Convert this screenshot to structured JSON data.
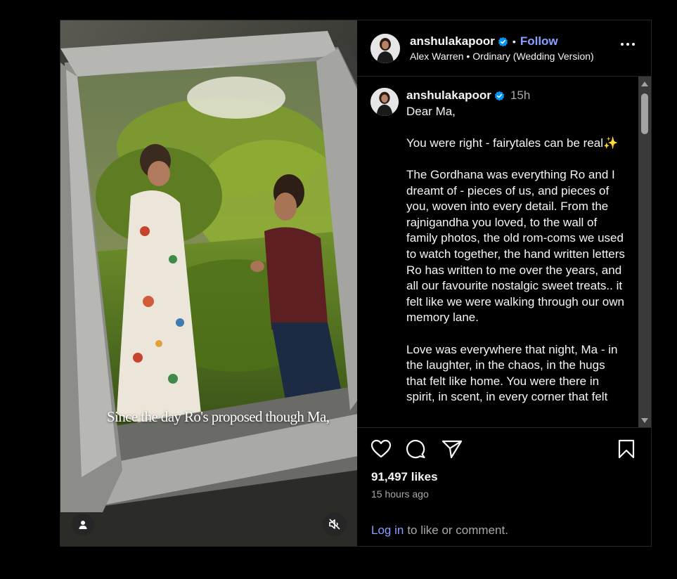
{
  "media": {
    "overlay_caption": "Since the day Ro's proposed though Ma,",
    "tag_icon": "user-icon",
    "mute_icon": "speaker-muted-icon"
  },
  "header": {
    "username": "anshulakapoor",
    "verified_icon": "verified-badge-icon",
    "separator": "•",
    "follow_label": "Follow",
    "audio_artist": "Alex Warren",
    "audio_separator": "•",
    "audio_track": "Ordinary (Wedding Version)",
    "more_icon": "more-options-icon"
  },
  "caption": {
    "username": "anshulakapoor",
    "time": "15h",
    "paragraphs": [
      "Dear Ma,",
      "You were right - fairytales can be real✨",
      "The Gordhana was everything Ro and I dreamt of - pieces of us, and pieces of you, woven into every detail. From the rajnigandha you loved, to the wall of family photos, the old rom-coms we used to watch together, the hand written letters Ro has written to me over the years, and all our favourite nostalgic sweet treats.. it felt like we were walking through our own memory lane.",
      "Love was everywhere that night, Ma - in the laughter, in the chaos, in the hugs that felt like home. You were there in spirit, in scent, in every corner that felt"
    ]
  },
  "actions": {
    "like_icon": "heart-icon",
    "comment_icon": "comment-icon",
    "share_icon": "share-icon",
    "save_icon": "bookmark-icon",
    "likes": "91,497 likes",
    "posted": "15 hours ago"
  },
  "footer": {
    "login_label": "Log in",
    "login_rest": "to like or comment."
  },
  "colors": {
    "background": "#000000",
    "link_blue": "#85a1ff",
    "verified_blue": "#0095f6",
    "muted_text": "#a8a8a8",
    "border": "#262626"
  }
}
